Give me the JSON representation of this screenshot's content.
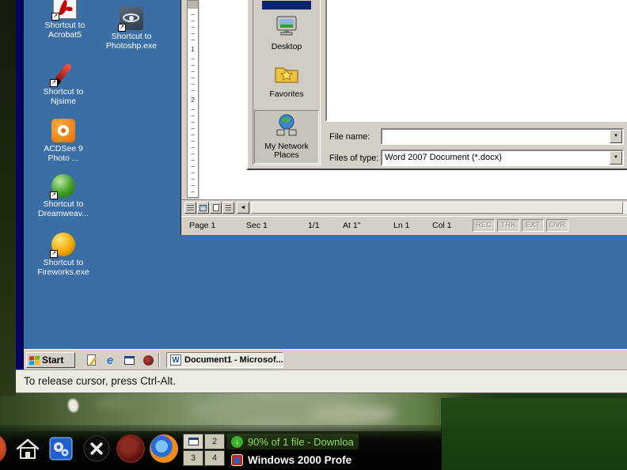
{
  "colors": {
    "desktop_blue": "#3A6EA5",
    "win_chrome_gray": "#D4D0C8",
    "vm_border_navy": "#05055E",
    "selection_blue": "#0A246A",
    "host_dark_green": "#1D3F15",
    "download_green": "#8EDB5C"
  },
  "glyphs": {
    "shortcut_arrow": "↗",
    "dropdown": "▼",
    "scroll_left": "◄",
    "down_arrow": "↓",
    "ie": "e",
    "word": "W"
  },
  "vm_desktop": {
    "icons": [
      {
        "label": "Shortcut to\nAcrobat5"
      },
      {
        "label": "Shortcut to\nPhotoshp.exe"
      },
      {
        "label": "Shortcut to\nNjsime"
      },
      {
        "label": "ACDSee 9\nPhoto ..."
      },
      {
        "label": "Shortcut to\nDreamweav..."
      },
      {
        "label": "Shortcut to\nFireworks.exe"
      }
    ]
  },
  "word": {
    "ruler_numbers": [
      "1",
      "2"
    ],
    "save_dialog": {
      "places": [
        {
          "label": "Desktop"
        },
        {
          "label": "Favorites"
        },
        {
          "label": "My Network\nPlaces"
        }
      ],
      "file_name_label": "File name:",
      "file_name_value": "",
      "files_of_type_label": "Files of type:",
      "files_of_type_value": "Word 2007 Document (*.docx)"
    },
    "status": {
      "fields": [
        "Page 1",
        "Sec 1",
        "1/1",
        "At 1\"",
        "Ln 1",
        "Col 1"
      ],
      "indicators": [
        "REC",
        "TRK",
        "EXT",
        "OVR"
      ]
    }
  },
  "vm_taskbar": {
    "start_label": "Start",
    "task_button": "Document1 - Microsof..."
  },
  "vm_status_message": "To release cursor, press Ctrl-Alt.",
  "host_panel": {
    "workspaces": [
      "2",
      "3",
      "4"
    ],
    "tasks": [
      {
        "label": "90% of 1 file - Downloa"
      },
      {
        "label": "Windows 2000 Profe"
      }
    ]
  }
}
